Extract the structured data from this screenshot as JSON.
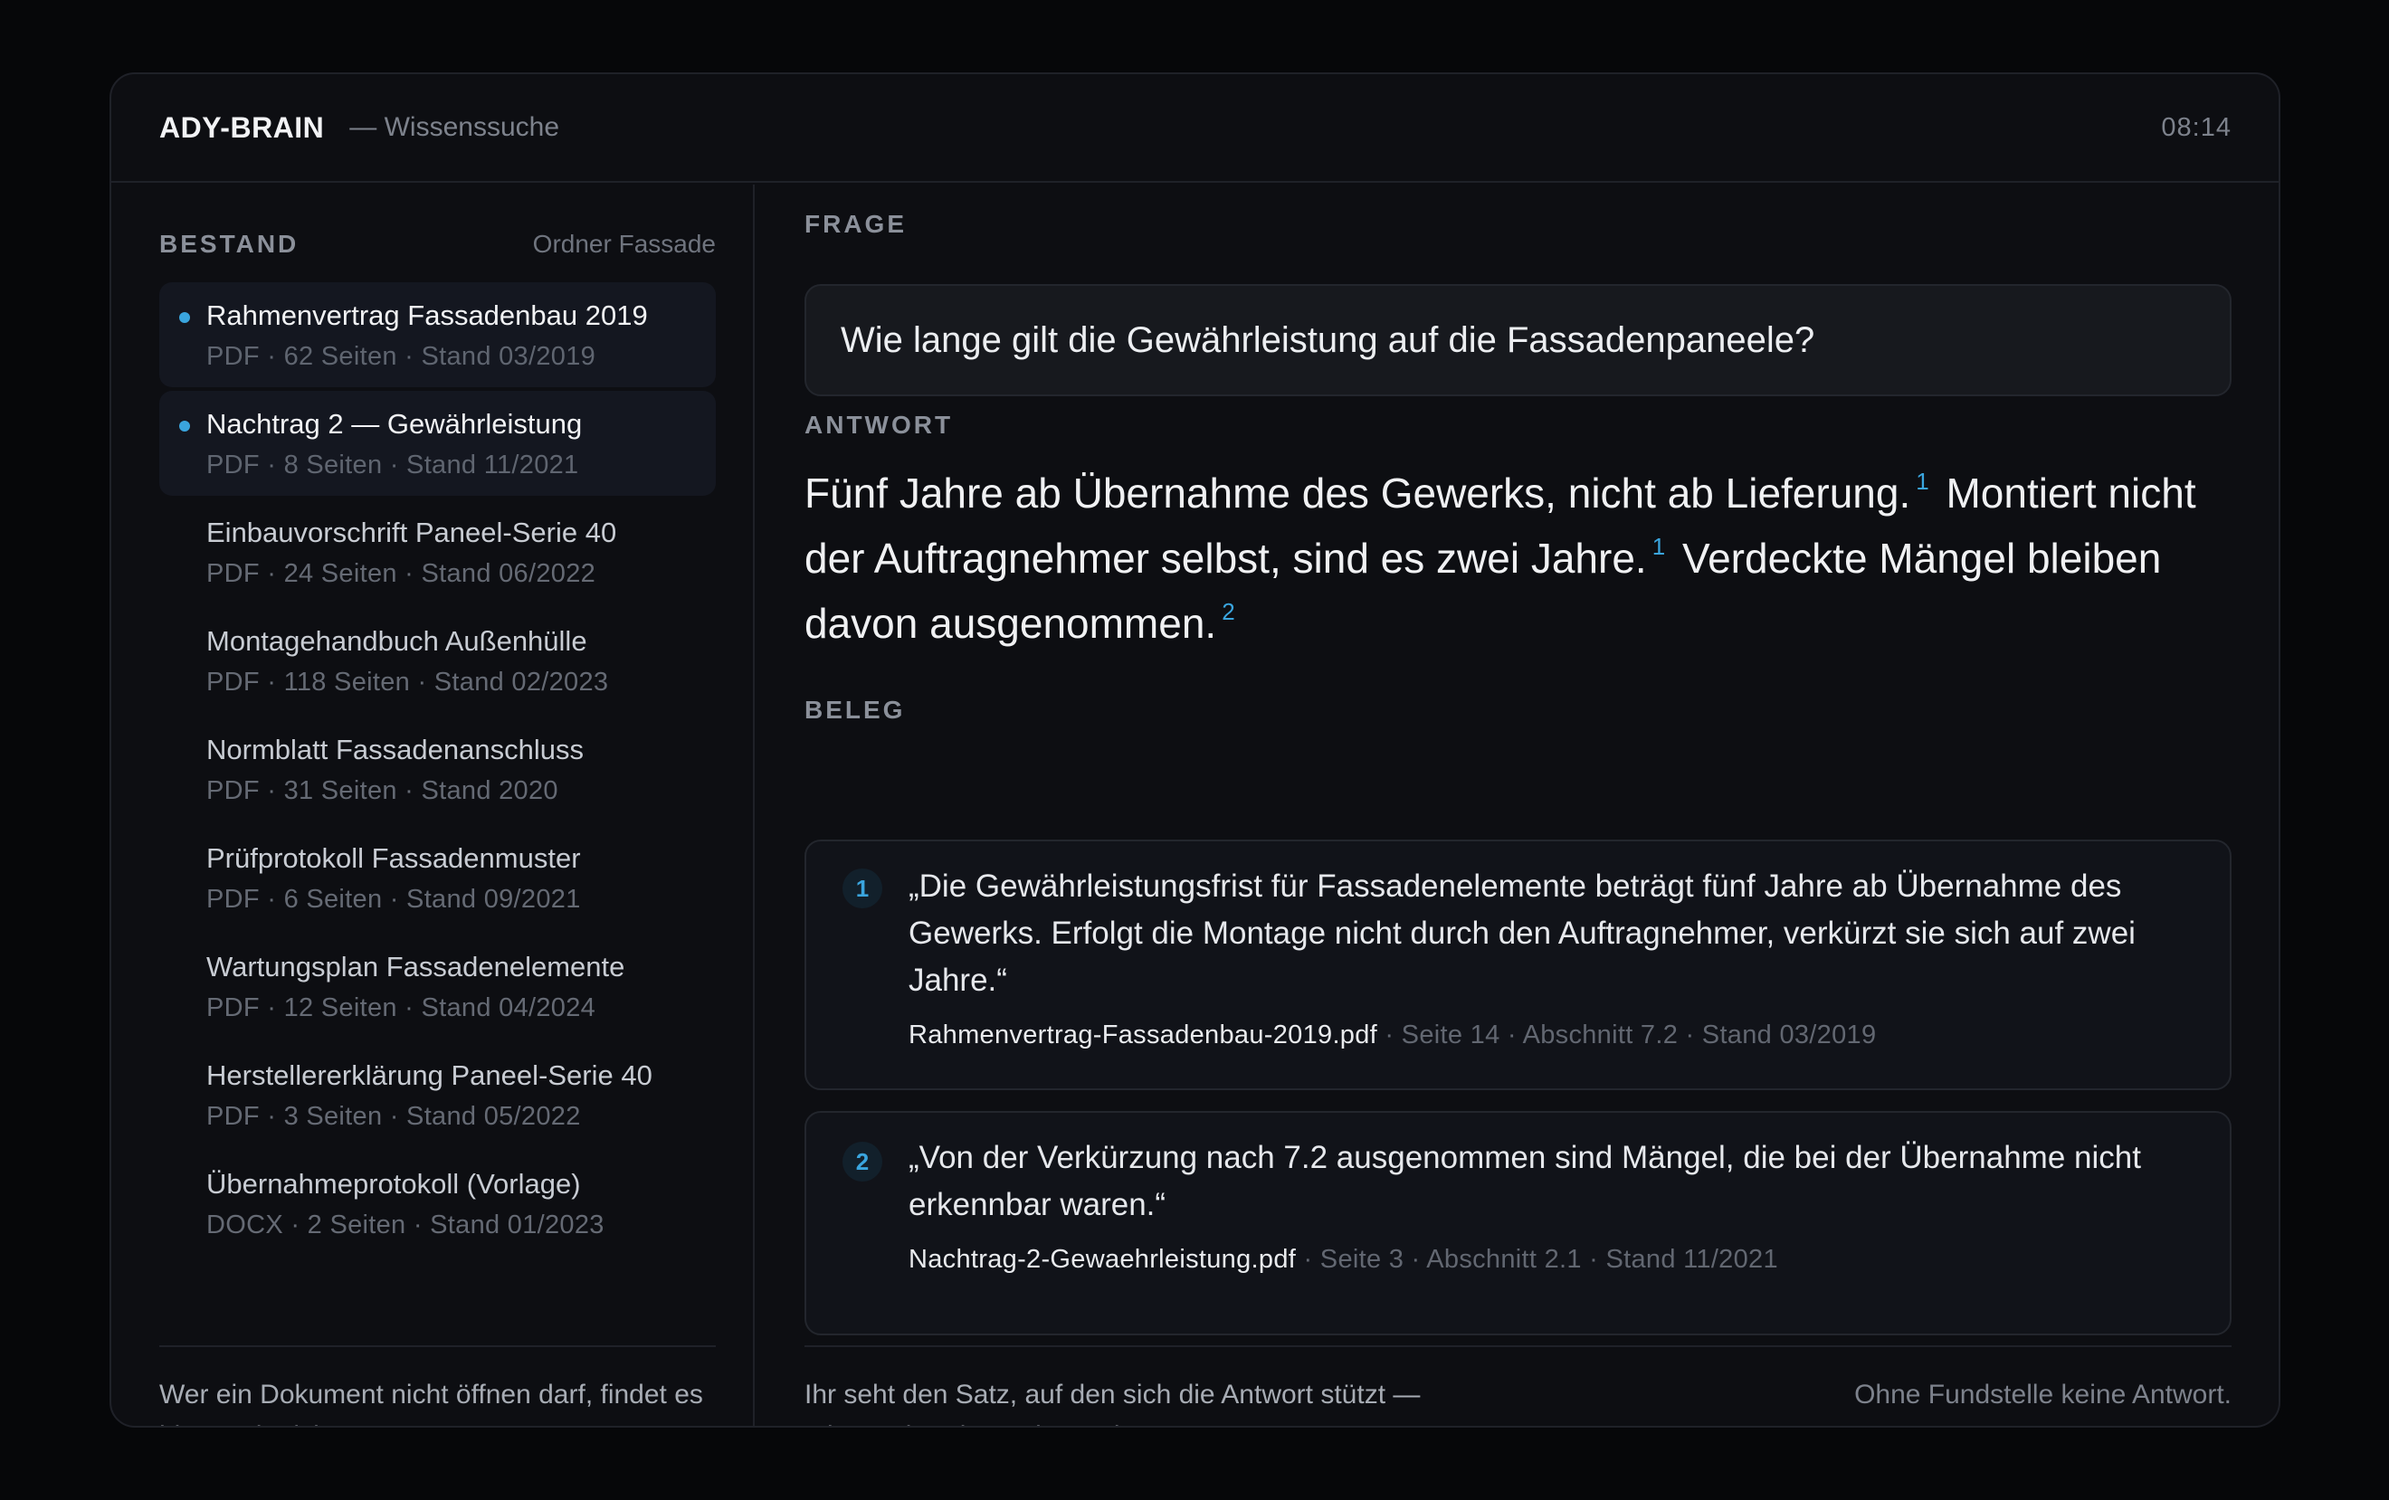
{
  "app": {
    "name": "ADY-BRAIN",
    "subtitle": "— Wissenssuche",
    "time": "08:14"
  },
  "sidebar": {
    "section_label": "BESTAND",
    "folder": "Ordner Fassade",
    "documents": [
      {
        "title": "Rahmenvertrag Fassadenbau 2019",
        "meta": "PDF · 62 Seiten · Stand 03/2019",
        "active": true
      },
      {
        "title": "Nachtrag 2 — Gewährleistung",
        "meta": "PDF · 8 Seiten · Stand 11/2021",
        "active": true
      },
      {
        "title": "Einbauvorschrift Paneel-Serie 40",
        "meta": "PDF · 24 Seiten · Stand 06/2022",
        "active": false
      },
      {
        "title": "Montagehandbuch Außenhülle",
        "meta": "PDF · 118 Seiten · Stand 02/2023",
        "active": false
      },
      {
        "title": "Normblatt Fassadenanschluss",
        "meta": "PDF · 31 Seiten · Stand 2020",
        "active": false
      },
      {
        "title": "Prüfprotokoll Fassadenmuster",
        "meta": "PDF · 6 Seiten · Stand 09/2021",
        "active": false
      },
      {
        "title": "Wartungsplan Fassadenelemente",
        "meta": "PDF · 12 Seiten · Stand 04/2024",
        "active": false
      },
      {
        "title": "Herstellererklärung Paneel-Serie 40",
        "meta": "PDF · 3 Seiten · Stand 05/2022",
        "active": false
      },
      {
        "title": "Übernahmeprotokoll (Vorlage)",
        "meta": "DOCX · 2 Seiten · Stand 01/2023",
        "active": false
      }
    ],
    "footer": "Wer ein Dokument nicht öffnen darf, findet es hier auch nicht."
  },
  "main": {
    "question_label": "FRAGE",
    "question": "Wie lange gilt die Gewährleistung auf die Fassadenpaneele?",
    "answer_label": "ANTWORT",
    "answer": [
      {
        "text": "Fünf Jahre ab Übernahme des Gewerks, nicht ab Lieferung.",
        "ref": "1"
      },
      {
        "text": "Montiert nicht der Auftragnehmer selbst, sind es zwei Jahre.",
        "ref": "1"
      },
      {
        "text": "Verdeckte Mängel bleiben davon ausgenommen.",
        "ref": "2"
      }
    ],
    "evidence_label": "BELEG",
    "evidence": [
      {
        "num": "1",
        "quote": "„Die Gewährleistungsfrist für Fassadenelemente beträgt fünf Jahre ab Übernahme des Gewerks. Erfolgt die Montage nicht durch den Auftragnehmer, verkürzt sie sich auf zwei Jahre.“",
        "file": "Rahmenvertrag-Fassadenbau-2019.pdf",
        "details": " · Seite 14 · Abschnitt 7.2 · Stand 03/2019"
      },
      {
        "num": "2",
        "quote": "„Von der Verkürzung nach 7.2 ausgenommen sind Mängel, die bei der Übernahme nicht erkennbar waren.“",
        "file": "Nachtrag-2-Gewaehrleistung.pdf",
        "details": " · Seite 3 · Abschnitt 2.1 · Stand 11/2021"
      }
    ],
    "footer_left": "Ihr seht den Satz, auf den sich die Antwort stützt — mit Datei, Seite und Stand.",
    "footer_right": "Ohne Fundstelle keine Antwort."
  },
  "colors": {
    "accent": "#3aa5de",
    "background": "#060709",
    "panel": "#0d0e12"
  }
}
